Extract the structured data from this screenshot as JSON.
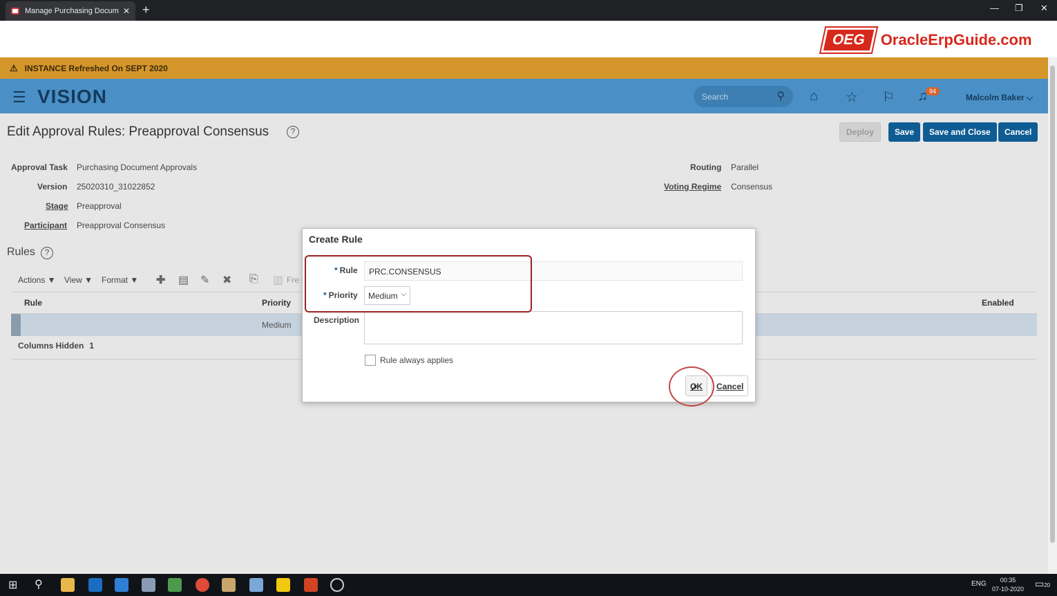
{
  "browser": {
    "tab_title": "Manage Purchasing Document A",
    "tab_close": "✕",
    "new_tab": "+",
    "minimize": "—",
    "restore": "❐",
    "close": "✕"
  },
  "brand": {
    "logo_box": "OEG",
    "logo_text": "OracleErpGuide.com"
  },
  "warning": {
    "icon": "⚠",
    "text": "INSTANCE Refreshed On SEPT 2020"
  },
  "header": {
    "logo": "VISION",
    "search_placeholder": "Search",
    "notification_count": "94",
    "user": "Malcolm Baker",
    "icons": [
      "menu-icon",
      "search-icon",
      "home-icon",
      "star-icon",
      "flag-icon",
      "bell-icon"
    ]
  },
  "page": {
    "title": "Edit Approval Rules: Preapproval Consensus",
    "help": "?",
    "buttons": {
      "deploy": "Deploy",
      "save": "Save",
      "save_close": "Save and Close",
      "cancel": "Cancel"
    }
  },
  "fields": {
    "approval_task": {
      "label": "Approval Task",
      "value": "Purchasing Document Approvals"
    },
    "version": {
      "label": "Version",
      "value": "25020310_31022852"
    },
    "stage": {
      "label": "Stage",
      "value": "Preapproval"
    },
    "participant": {
      "label": "Participant",
      "value": "Preapproval Consensus"
    },
    "routing": {
      "label": "Routing",
      "value": "Parallel"
    },
    "voting_regime": {
      "label": "Voting Regime",
      "value": "Consensus"
    }
  },
  "rules": {
    "title": "Rules",
    "toolbar": {
      "actions": "Actions ▼",
      "view": "View ▼",
      "format": "Format ▼",
      "freeze": "Fre"
    },
    "columns": {
      "rule": "Rule",
      "priority": "Priority",
      "enabled": "Enabled"
    },
    "rows": [
      {
        "rule": "",
        "priority": "Medium"
      }
    ],
    "columns_hidden_label": "Columns Hidden",
    "columns_hidden_count": "1"
  },
  "dialog": {
    "title": "Create Rule",
    "required_mark": "*",
    "rule_label": "Rule",
    "rule_value": "PRC.CONSENSUS",
    "priority_label": "Priority",
    "priority_value": "Medium",
    "description_label": "Description",
    "description_value": "",
    "always_applies_label": "Rule always applies",
    "ok": "OK",
    "cancel": "Cancel"
  },
  "taskbar": {
    "language": "ENG",
    "time": "00:35",
    "date": "07-10-2020",
    "notifications": "20"
  },
  "colors": {
    "accent": "#0f5c94",
    "header": "#4a90c6",
    "warning": "#d4952a",
    "highlight": "#9b2121"
  }
}
